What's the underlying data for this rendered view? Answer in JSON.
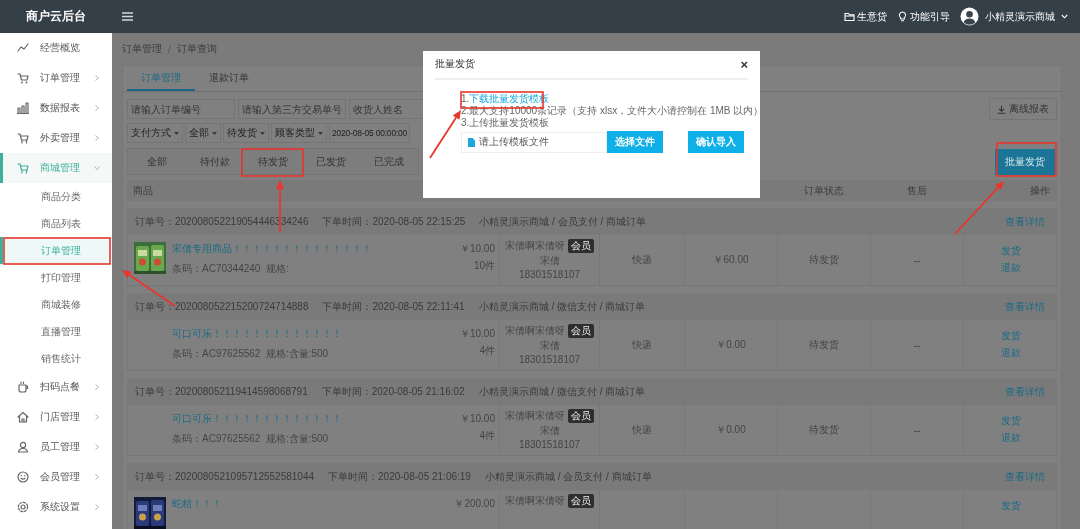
{
  "app": {
    "title": "商户云后台"
  },
  "topbar": {
    "links": [
      {
        "label": "生意贷"
      },
      {
        "label": "功能引导"
      }
    ],
    "user": {
      "name": "小精灵演示商城"
    }
  },
  "sidebar": {
    "items": [
      {
        "label": "经营概览",
        "kind": "link",
        "selected": false
      },
      {
        "label": "订单管理",
        "kind": "group",
        "expanded": false,
        "selected": false
      },
      {
        "label": "数据报表",
        "kind": "group",
        "expanded": false,
        "selected": false
      },
      {
        "label": "外卖管理",
        "kind": "group",
        "expanded": false,
        "selected": false
      },
      {
        "label": "商城管理",
        "kind": "group",
        "expanded": true,
        "selected": true,
        "children": [
          {
            "label": "商品分类",
            "selected": false
          },
          {
            "label": "商品列表",
            "selected": false
          },
          {
            "label": "订单管理",
            "selected": true
          },
          {
            "label": "打印管理",
            "selected": false
          },
          {
            "label": "商城装修",
            "selected": false
          },
          {
            "label": "直播管理",
            "selected": false
          },
          {
            "label": "销售统计",
            "selected": false
          }
        ]
      },
      {
        "label": "扫码点餐",
        "kind": "group",
        "expanded": false,
        "selected": false
      },
      {
        "label": "门店管理",
        "kind": "group",
        "expanded": false,
        "selected": false
      },
      {
        "label": "员工管理",
        "kind": "group",
        "expanded": false,
        "selected": false
      },
      {
        "label": "会员管理",
        "kind": "group",
        "expanded": false,
        "selected": false
      },
      {
        "label": "系统设置",
        "kind": "group",
        "expanded": false,
        "selected": false
      }
    ]
  },
  "breadcrumb": {
    "items": [
      "订单管理",
      "订单查询"
    ],
    "separator": "/"
  },
  "tabs": [
    {
      "label": "订单管理",
      "selected": true
    },
    {
      "label": "退款订单",
      "selected": false
    }
  ],
  "filters": {
    "inputs": [
      {
        "placeholder": "请输入订单编号"
      },
      {
        "placeholder": "请输入第三方交易单号"
      },
      {
        "placeholder": "收货人姓名"
      }
    ],
    "selects": [
      {
        "value": "支付方式"
      },
      {
        "value": "全部"
      },
      {
        "value": "待发货"
      },
      {
        "value": "顾客类型"
      }
    ],
    "date": {
      "value": "2020-08-05 00:00:00"
    },
    "export_button": "离线报表"
  },
  "status_tabs": [
    {
      "label": "全部",
      "selected": false
    },
    {
      "label": "待付款",
      "selected": false
    },
    {
      "label": "待发货",
      "selected": false
    },
    {
      "label": "已发货",
      "selected": false
    },
    {
      "label": "已完成",
      "selected": false
    }
  ],
  "batch_button": "批量发货",
  "table": {
    "columns": [
      "商品",
      "订单状态",
      "售后",
      "操作"
    ],
    "orders": [
      {
        "order_no": "订单号：202008052219054446334246",
        "time": "下单时间：2020-08-05 22:15:25",
        "source": "小精灵演示商城 / 会员支付 / 商城订单",
        "detail_link": "查看详情",
        "item": {
          "name": "宋倩专用商品！！！！！！！！！！！！！！",
          "code": "条码：AC70344240  规格:",
          "price": "￥10.00",
          "quantity": "10件"
        },
        "buyer": {
          "nickname": "宋倩啊宋倩呀",
          "badge": "会员",
          "name": "宋倩",
          "phone": "18301518107"
        },
        "delivery": "快递",
        "amount": "￥60.00",
        "status": "待发货",
        "after_sales": "--",
        "actions": [
          "发货",
          "退款"
        ]
      },
      {
        "order_no": "订单号：202008052215200724714888",
        "time": "下单时间：2020-08-05 22:11:41",
        "source": "小精灵演示商城 / 微信支付 / 商城订单",
        "detail_link": "查看详情",
        "item": {
          "name": "可口可乐！！！！！！！！！！！！！",
          "code": "条码：AC97625562  规格:含量:500",
          "price": "￥10.00",
          "quantity": "4件"
        },
        "buyer": {
          "nickname": "宋倩啊宋倩呀",
          "badge": "会员",
          "name": "宋倩",
          "phone": "18301518107"
        },
        "delivery": "快递",
        "amount": "￥0.00",
        "status": "待发货",
        "after_sales": "--",
        "actions": [
          "发货",
          "退款"
        ]
      },
      {
        "order_no": "订单号：202008052119414598068791",
        "time": "下单时间：2020-08-05 21:16:02",
        "source": "小精灵演示商城 / 微信支付 / 商城订单",
        "detail_link": "查看详情",
        "item": {
          "name": "可口可乐！！！！！！！！！！！！！",
          "code": "条码：AC97625562  规格:含量:500",
          "price": "￥10.00",
          "quantity": "4件"
        },
        "buyer": {
          "nickname": "宋倩啊宋倩呀",
          "badge": "会员",
          "name": "宋倩",
          "phone": "18301518107"
        },
        "delivery": "快递",
        "amount": "￥0.00",
        "status": "待发货",
        "after_sales": "--",
        "actions": [
          "发货",
          "退款"
        ]
      },
      {
        "order_no": "订单号：2020080521095712552581044",
        "time": "下单时间：2020-08-05 21:06:19",
        "source": "小精灵演示商城 / 会员支付 / 商城订单",
        "detail_link": "查看详情",
        "item": {
          "name": "蛇精！！！",
          "price": "￥200.00"
        },
        "buyer": {
          "nickname": "宋倩啊宋倩呀",
          "badge": "会员"
        },
        "actions": [
          "发货"
        ]
      }
    ]
  },
  "modal": {
    "title": "批量发货",
    "close": "×",
    "steps": [
      {
        "number": "1.",
        "text": "下载批量发货模板",
        "kind": "link"
      },
      {
        "number": "2.",
        "text": "最大支持10000条记录（支持 xlsx，文件大小请控制在 1MB 以内）",
        "kind": "text"
      },
      {
        "number": "3.",
        "text": "上传批量发货模板",
        "kind": "text"
      }
    ],
    "upload": {
      "placeholder": "请上传模板文件",
      "choose_button": "选择文件",
      "confirm_button": "确认导入"
    }
  }
}
